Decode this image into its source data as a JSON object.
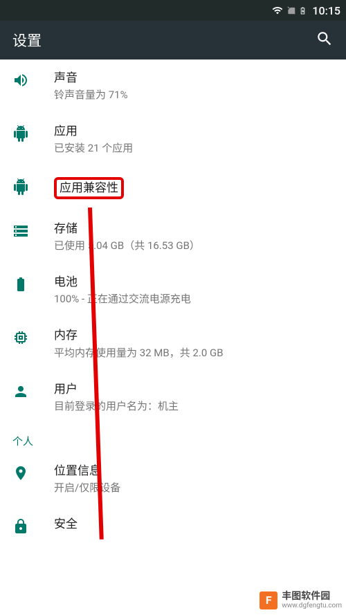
{
  "statusbar": {
    "time": "10:15"
  },
  "appbar": {
    "title": "设置"
  },
  "items": [
    {
      "title": "声音",
      "sub": "铃声音量为 71%"
    },
    {
      "title": "应用",
      "sub": "已安装 21 个应用"
    },
    {
      "title": "应用兼容性",
      "sub": ""
    },
    {
      "title": "存储",
      "sub": "已使用 5.04 GB（共 16.53 GB）"
    },
    {
      "title": "电池",
      "sub": "100% - 正在通过交流电源充电"
    },
    {
      "title": "内存",
      "sub": "平均内存使用量为 32 MB，共 2.0 GB"
    },
    {
      "title": "用户",
      "sub": "目前登录的用户名为：机主"
    }
  ],
  "section_personal": "个人",
  "items2": [
    {
      "title": "位置信息",
      "sub": "开启/仅限设备"
    },
    {
      "title": "安全",
      "sub": ""
    }
  ],
  "watermark": {
    "name": "丰图软件园",
    "url": "www.dgfengtu.com"
  }
}
